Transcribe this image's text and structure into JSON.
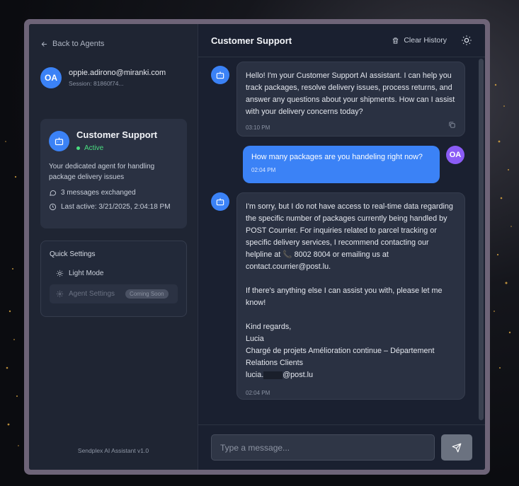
{
  "sidebar": {
    "back_label": "Back to Agents",
    "user": {
      "initials": "OA",
      "email": "oppie.adirono@miranki.com",
      "session": "Session: 81860f74..."
    },
    "agent": {
      "name": "Customer Support",
      "status": "Active",
      "description": "Your dedicated agent for handling package delivery issues",
      "messages_count": "3 messages exchanged",
      "last_active": "Last active: 3/21/2025, 2:04:18 PM"
    },
    "quick_settings": {
      "title": "Quick Settings",
      "light_mode": "Light Mode",
      "agent_settings": "Agent Settings",
      "coming_soon": "Coming Soon"
    },
    "version": "Sendplex AI Assistant v1.0"
  },
  "header": {
    "title": "Customer Support",
    "clear_label": "Clear History"
  },
  "messages": [
    {
      "role": "bot",
      "text": "Hello! I'm your Customer Support AI assistant. I can help you track packages, resolve delivery issues, process returns, and answer any questions about your shipments. How can I assist with your delivery concerns today?",
      "time": "03:10 PM"
    },
    {
      "role": "user",
      "initials": "OA",
      "text": "How many packages are you handeling right now?",
      "time": "02:04 PM"
    },
    {
      "role": "bot",
      "p1": "I'm sorry, but I do not have access to real-time data regarding the specific number of packages currently being handled by POST Courrier. For inquiries related to parcel tracking or specific delivery services, I recommend contacting our helpline at 📞 8002 8004 or emailing us at contact.courrier@post.lu.",
      "p2": "If there's anything else I can assist you with, please let me know!",
      "sign1": "Kind regards,",
      "sign2": "Lucia",
      "sign3": "Chargé de projets Amélioration continue – Département Relations Clients",
      "email_prefix": "lucia.",
      "email_suffix": "@post.lu",
      "time": "02:04 PM"
    }
  ],
  "composer": {
    "placeholder": "Type a message..."
  }
}
